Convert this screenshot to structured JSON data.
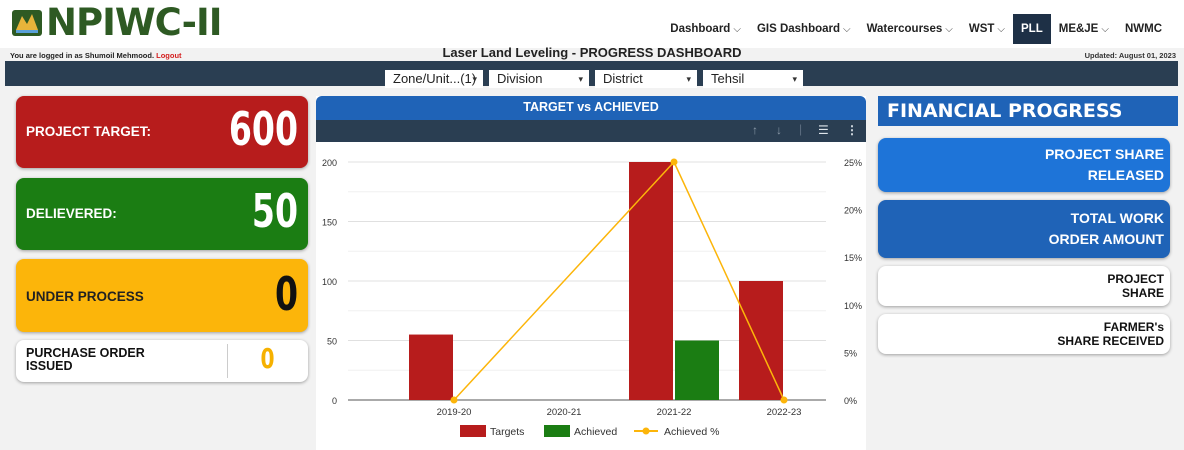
{
  "header": {
    "logo_text": "NPIWC-II",
    "nav": [
      {
        "label": "Dashboard",
        "dropdown": true,
        "active": false
      },
      {
        "label": "GIS Dashboard",
        "dropdown": true,
        "active": false
      },
      {
        "label": "Watercourses",
        "dropdown": true,
        "active": false
      },
      {
        "label": "WST",
        "dropdown": true,
        "active": false
      },
      {
        "label": "PLL",
        "dropdown": false,
        "active": true
      },
      {
        "label": "ME&JE",
        "dropdown": true,
        "active": false
      },
      {
        "label": "NWMC",
        "dropdown": false,
        "active": false
      }
    ],
    "login_prefix": "You are logged in as Shumoil Mehmood.",
    "logout_label": "Logout",
    "page_title": "Laser Land Leveling - PROGRESS DASHBOARD",
    "updated": "Updated: August 01, 2023"
  },
  "filters": [
    {
      "label": "Zone/Unit...(1)",
      "caret": "▾"
    },
    {
      "label": "Division",
      "caret": "▾"
    },
    {
      "label": "District",
      "caret": "▾"
    },
    {
      "label": "Tehsil",
      "caret": "▾"
    }
  ],
  "kpis": {
    "project_target": {
      "label": "PROJECT TARGET:",
      "value": "600"
    },
    "delivered": {
      "label": "DELIEVERED:",
      "value": "50"
    },
    "under_process": {
      "label": "UNDER PROCESS",
      "value": "0"
    },
    "purchase_order": {
      "label_line1": "PURCHASE ORDER",
      "label_line2": "ISSUED",
      "value": "0"
    }
  },
  "chart_panel": {
    "title": "TARGET vs ACHIEVED",
    "toolbar_icons": [
      "arrow-up-icon",
      "arrow-down-icon",
      "filter-icon",
      "more-vert-icon"
    ]
  },
  "chart_data": {
    "type": "bar",
    "categories": [
      "2019-20",
      "2020-21",
      "2021-22",
      "2022-23"
    ],
    "series": [
      {
        "name": "Targets",
        "type": "bar",
        "axis": "left",
        "color": "#b71c1c",
        "values": [
          55,
          0,
          200,
          100
        ]
      },
      {
        "name": "Achieved",
        "type": "bar",
        "axis": "left",
        "color": "#1b7d13",
        "values": [
          0,
          0,
          50,
          0
        ]
      },
      {
        "name": "Achieved %",
        "type": "line",
        "axis": "right",
        "color": "#fcb50a",
        "values": [
          0,
          null,
          25,
          0
        ]
      }
    ],
    "ylim": [
      0,
      200
    ],
    "yticks": [
      "0",
      "50",
      "100",
      "150",
      "200"
    ],
    "y2lim": [
      0,
      25
    ],
    "y2ticks": [
      "0%",
      "5%",
      "10%",
      "15%",
      "20%",
      "25%"
    ],
    "grid": true,
    "legend_position": "bottom"
  },
  "financial": {
    "title": "FINANCIAL PROGRESS",
    "cards": {
      "project_share_released": [
        "PROJECT SHARE",
        "RELEASED"
      ],
      "total_work_order": [
        "TOTAL WORK",
        "ORDER AMOUNT"
      ],
      "project_share": [
        "PROJECT",
        "SHARE"
      ],
      "farmers_share": [
        "FARMER's",
        "SHARE RECEIVED"
      ]
    }
  },
  "colors": {
    "brand_green": "#2e5a23",
    "navy": "#2a3e52",
    "blue": "#1f63b7",
    "red": "#b71c1c",
    "green": "#1b7d13",
    "amber": "#fcb50a"
  }
}
